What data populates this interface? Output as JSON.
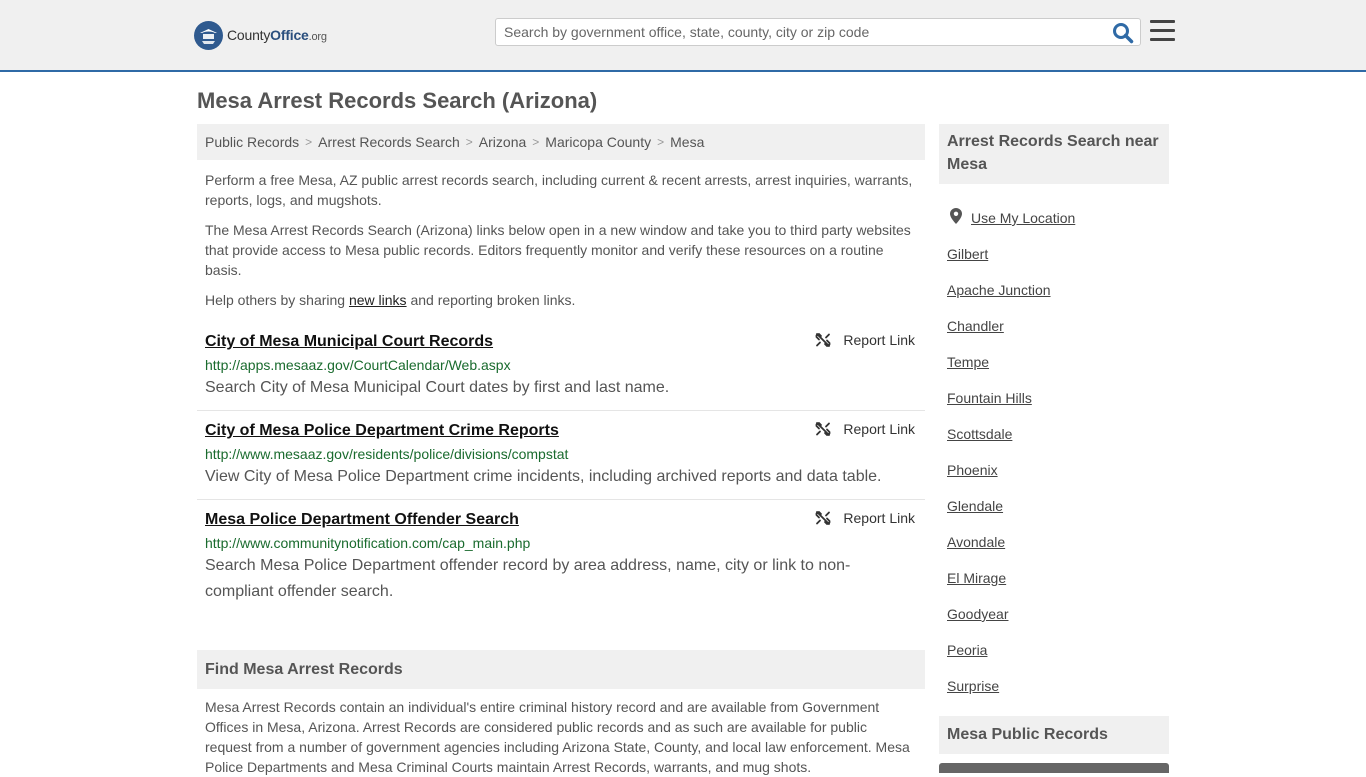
{
  "header": {
    "logo_name": "County",
    "logo_bold": "Office",
    "logo_tld": ".org",
    "search_placeholder": "Search by government office, state, county, city or zip code",
    "accent": "#2f6aa6"
  },
  "page": {
    "title": "Mesa Arrest Records Search (Arizona)"
  },
  "breadcrumb": [
    "Public Records",
    "Arrest Records Search",
    "Arizona",
    "Maricopa County",
    "Mesa"
  ],
  "intro": {
    "p1": "Perform a free Mesa, AZ public arrest records search, including current & recent arrests, arrest inquiries, warrants, reports, logs, and mugshots.",
    "p2": "The Mesa Arrest Records Search (Arizona) links below open in a new window and take you to third party websites that provide access to Mesa public records. Editors frequently monitor and verify these resources on a routine basis.",
    "p3_before": "Help others by sharing ",
    "p3_link": "new links",
    "p3_after": " and reporting broken links."
  },
  "results": [
    {
      "title": "City of Mesa Municipal Court Records",
      "url": "http://apps.mesaaz.gov/CourtCalendar/Web.aspx",
      "desc": "Search City of Mesa Municipal Court dates by first and last name.",
      "report": "Report Link"
    },
    {
      "title": "City of Mesa Police Department Crime Reports",
      "url": "http://www.mesaaz.gov/residents/police/divisions/compstat",
      "desc": "View City of Mesa Police Department crime incidents, including archived reports and data table.",
      "report": "Report Link"
    },
    {
      "title": "Mesa Police Department Offender Search",
      "url": "http://www.communitynotification.com/cap_main.php",
      "desc": "Search Mesa Police Department offender record by area address, name, city or link to non-compliant offender search.",
      "report": "Report Link"
    }
  ],
  "find_section": {
    "heading": "Find Mesa Arrest Records",
    "body": "Mesa Arrest Records contain an individual's entire criminal history record and are available from Government Offices in Mesa, Arizona. Arrest Records are considered public records and as such are available for public request from a number of government agencies including Arizona State, County, and local law enforcement. Mesa Police Departments and Mesa Criminal Courts maintain Arrest Records, warrants, and mug shots."
  },
  "sidebar": {
    "heading": "Arrest Records Search near Mesa",
    "use_location": "Use My Location",
    "cities": [
      "Gilbert",
      "Apache Junction",
      "Chandler",
      "Tempe",
      "Fountain Hills",
      "Scottsdale",
      "Phoenix",
      "Glendale",
      "Avondale",
      "El Mirage",
      "Goodyear",
      "Peoria",
      "Surprise"
    ],
    "heading2": "Mesa Public Records"
  }
}
